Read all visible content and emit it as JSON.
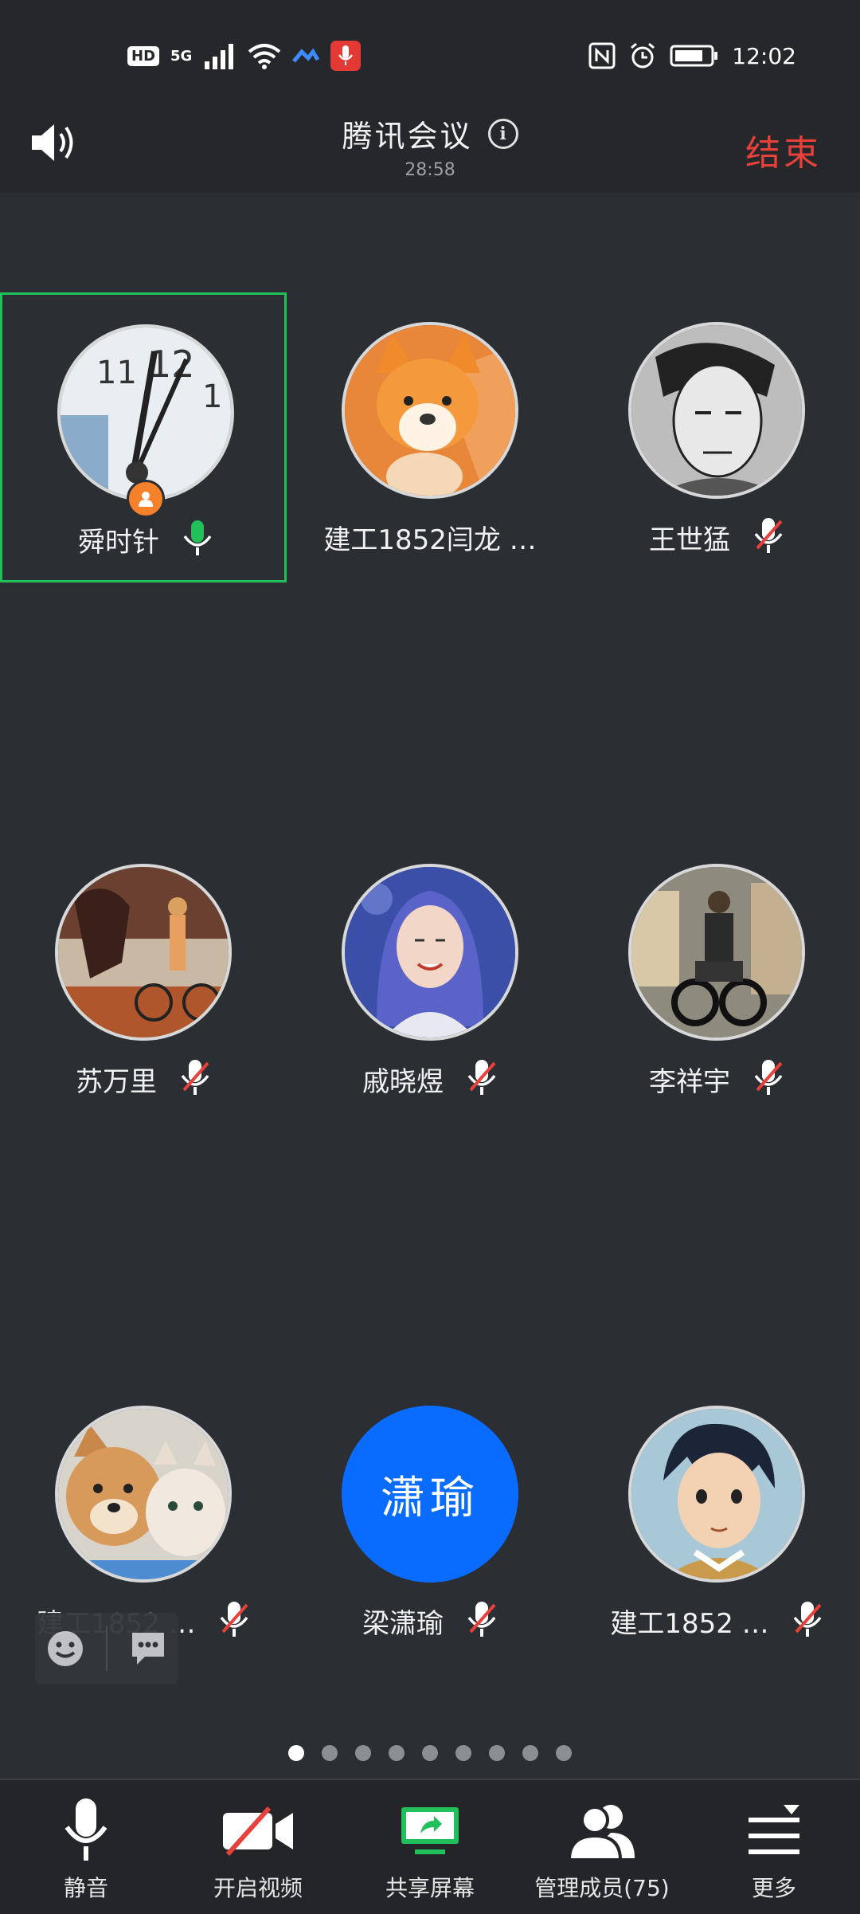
{
  "status_bar": {
    "hd": "HD",
    "network": "5G",
    "time": "12:02"
  },
  "header": {
    "title": "腾讯会议",
    "timer": "28:58",
    "end_label": "结束"
  },
  "participants": [
    {
      "name": "舜时针",
      "mic": "on",
      "host": true,
      "active": true,
      "avatar": "clock"
    },
    {
      "name": "建工1852闫龙 …",
      "mic": "none",
      "avatar": "corgi"
    },
    {
      "name": "王世猛",
      "mic": "muted",
      "avatar": "manga"
    },
    {
      "name": "苏万里",
      "mic": "muted",
      "avatar": "shadow"
    },
    {
      "name": "戚晓煜",
      "mic": "muted",
      "avatar": "singer"
    },
    {
      "name": "李祥宇",
      "mic": "muted",
      "avatar": "motorbike"
    },
    {
      "name": "建工1852 …",
      "mic": "muted",
      "avatar": "dog-cat"
    },
    {
      "name": "梁潇瑜",
      "mic": "muted",
      "avatar": "text",
      "avatar_text": "潇瑜"
    },
    {
      "name": "建工1852 …",
      "mic": "muted",
      "avatar": "anime-boy"
    }
  ],
  "pagination": {
    "current": 1,
    "total": 9
  },
  "toolbar": {
    "mute": "静音",
    "video": "开启视频",
    "share": "共享屏幕",
    "members": "管理成员(75)",
    "more": "更多"
  },
  "colors": {
    "background": "#2b2e33",
    "end_red": "#e8413b",
    "active_green": "#21c05a",
    "host_orange": "#f5812b",
    "avatar_blue": "#0a6cff"
  }
}
